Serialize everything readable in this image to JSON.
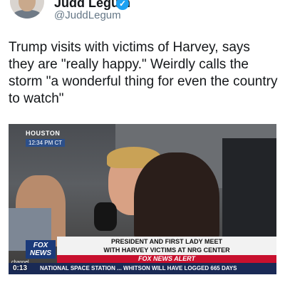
{
  "tweet": {
    "author_name": "Judd Legum",
    "handle": "@JuddLegum",
    "verified_icon": "verified-badge-icon",
    "text": "Trump visits with victims of Harvey, says they are \"really happy.\" Weirdly calls the storm \"a wonderful thing for even the country to watch\""
  },
  "video": {
    "station_label": "HOUSTON",
    "station_time": "12:34 PM CT",
    "logo_line1": "FOX",
    "logo_line2": "NEWS",
    "channel_label": "channel",
    "headline_line1": "PRESIDENT AND FIRST LADY MEET",
    "headline_line2": "WITH HARVEY VICTIMS AT NRG CENTER",
    "alert_label": "FOX NEWS ALERT",
    "ticker_text": "NATIONAL SPACE STATION ... WHITSON WILL HAVE LOGGED 665 DAYS",
    "timestamp": "0:13"
  },
  "colors": {
    "verified_blue": "#1da1f2",
    "alert_red": "#c8102e",
    "ticker_navy": "#1a2a55"
  }
}
